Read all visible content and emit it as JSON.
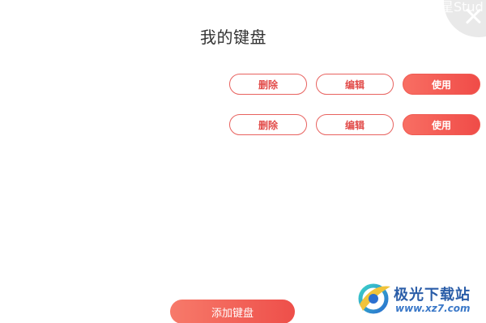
{
  "header": {
    "title": "我的键盘",
    "corner_text": "星Stud",
    "close_icon": "close-icon"
  },
  "keyboards": [
    {
      "delete_label": "删除",
      "edit_label": "编辑",
      "use_label": "使用"
    },
    {
      "delete_label": "删除",
      "edit_label": "编辑",
      "use_label": "使用"
    }
  ],
  "footer": {
    "add_label": "添加键盘"
  },
  "watermark": {
    "name": "极光下载站",
    "url": "www.xz7.com"
  },
  "colors": {
    "accent": "#f05a52",
    "accent_text": "#e24d4b",
    "title_text": "#333333",
    "watermark_blue": "#2a5da8"
  }
}
